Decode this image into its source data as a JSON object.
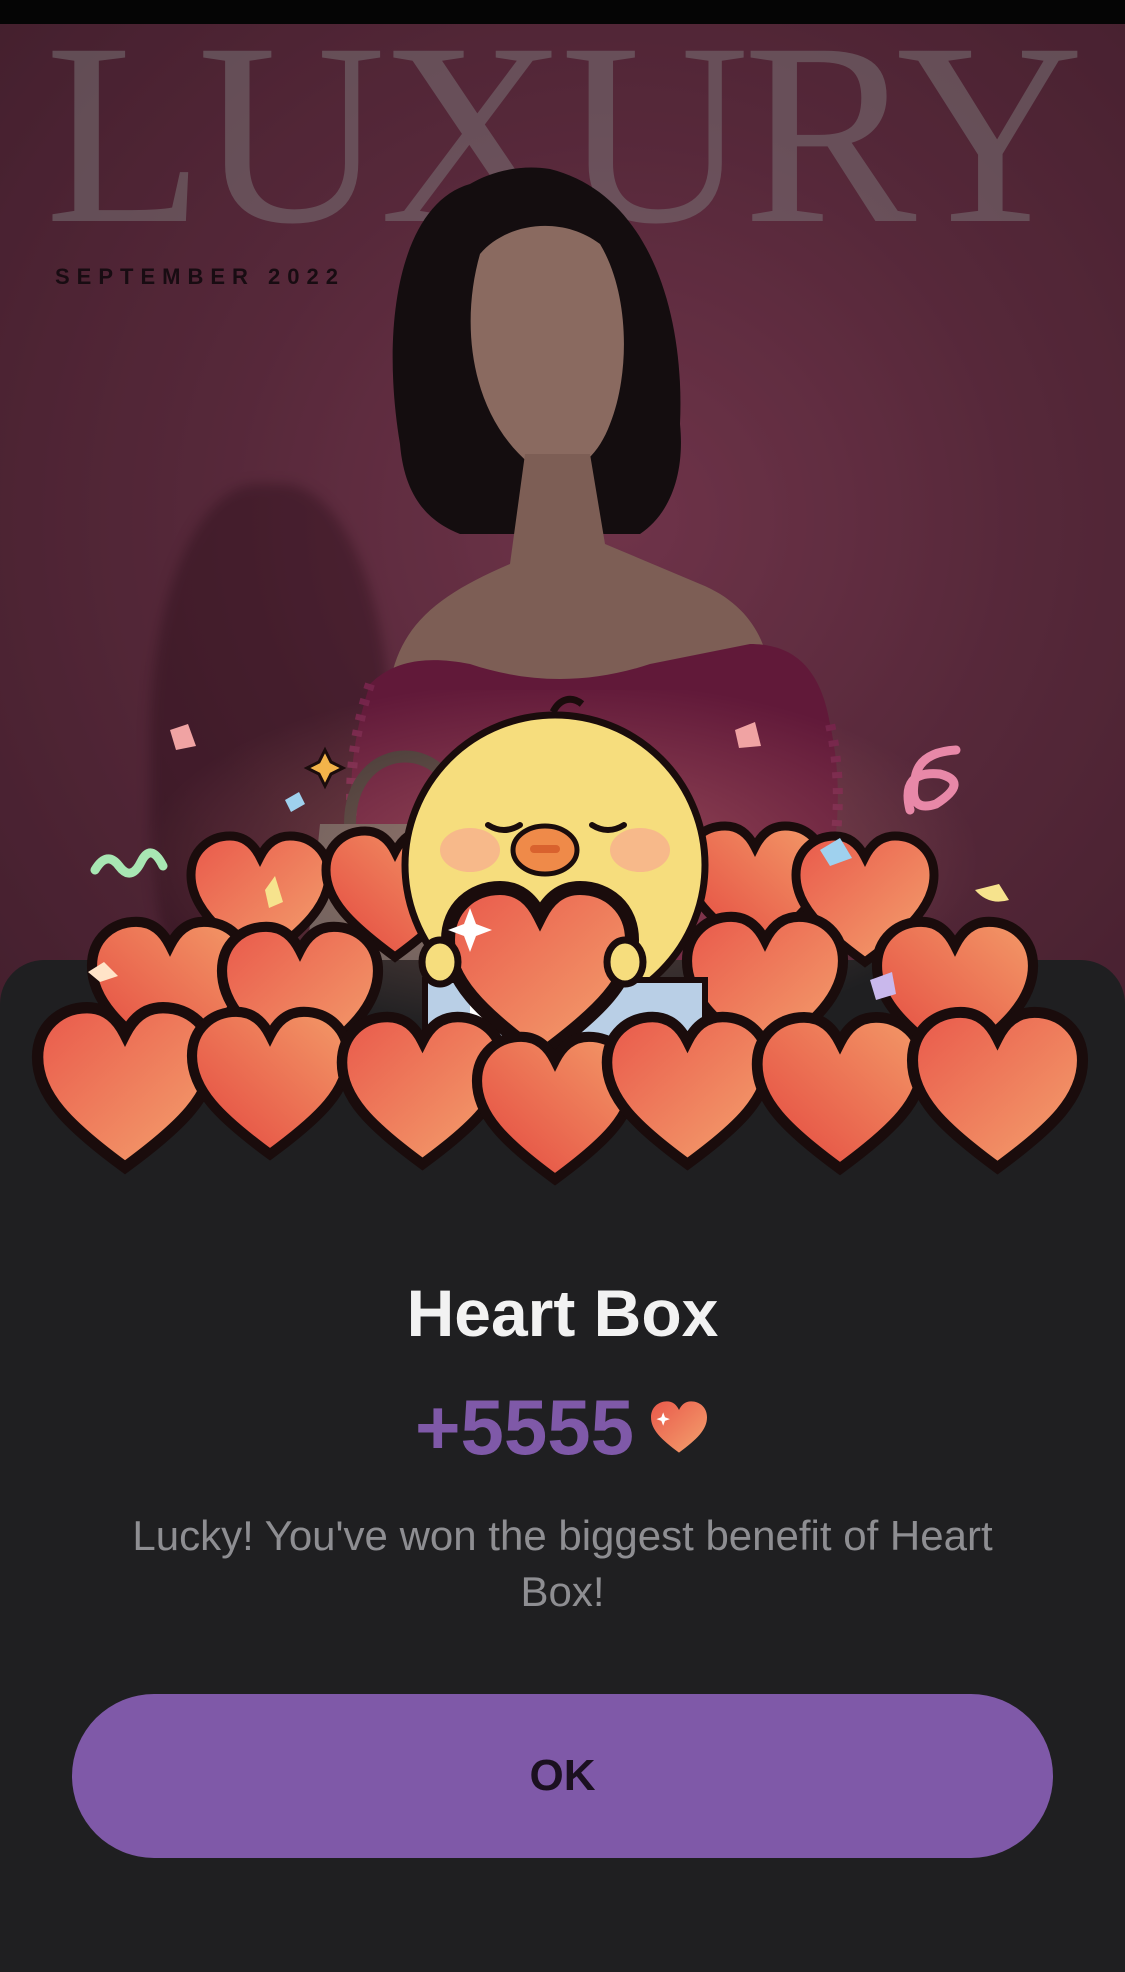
{
  "cover": {
    "wordmark": "LUXURY",
    "issue": "SEPTEMBER 2022"
  },
  "dialog": {
    "title": "Heart Box",
    "reward_amount": "+5555",
    "reward_icon": "heart-icon",
    "message": "Lucky! You've won the biggest benefit of Heart Box!",
    "ok_label": "OK"
  },
  "colors": {
    "accent": "#7f59a8",
    "sheet_background": "#1f1f21",
    "title_text": "#f2f2f2",
    "message_text": "#8e8e92"
  }
}
